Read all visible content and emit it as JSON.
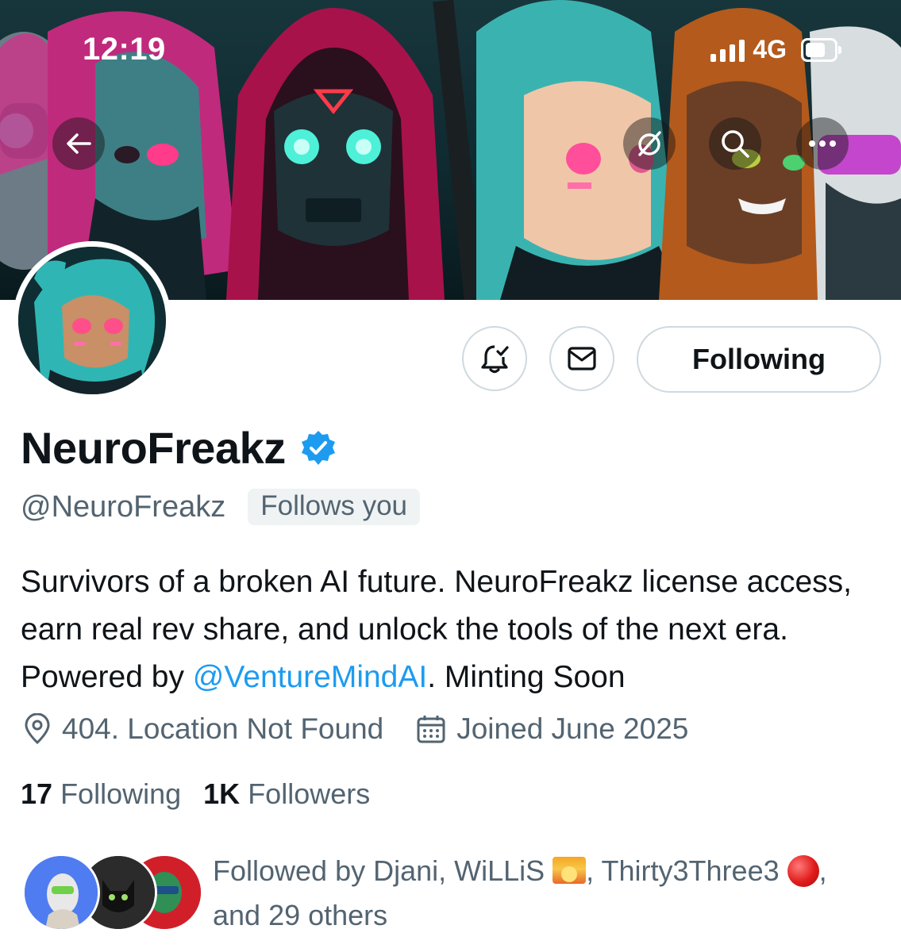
{
  "status_bar": {
    "time": "12:19",
    "network": "4G"
  },
  "nav": {
    "back_icon": "arrow-left-icon",
    "grok_icon": "grok-icon",
    "search_icon": "search-icon",
    "more_icon": "more-dots-icon"
  },
  "actions": {
    "notify_icon": "bell-check-icon",
    "message_icon": "mail-icon",
    "following_label": "Following"
  },
  "profile": {
    "name": "NeuroFreakz",
    "verified": true,
    "handle": "@NeuroFreakz",
    "follows_you": "Follows you",
    "bio_part1": "Survivors of a broken AI future. NeuroFreakz license access, earn real rev share, and unlock the tools of the next era. Powered by ",
    "bio_mention": "@VentureMindAI",
    "bio_part2": ". Minting Soon",
    "location": "404. Location Not Found",
    "joined": "Joined June 2025"
  },
  "counts": {
    "following_num": "17",
    "following_label": "Following",
    "followers_num": "1K",
    "followers_label": "Followers"
  },
  "followed_by": {
    "prefix": "Followed by Djani, WiLLiS ",
    "mid": ", Thirty3Three3 ",
    "suffix": ", and 29 others"
  },
  "colors": {
    "accent": "#1d9bf0",
    "text": "#0f1419",
    "muted": "#536471"
  }
}
